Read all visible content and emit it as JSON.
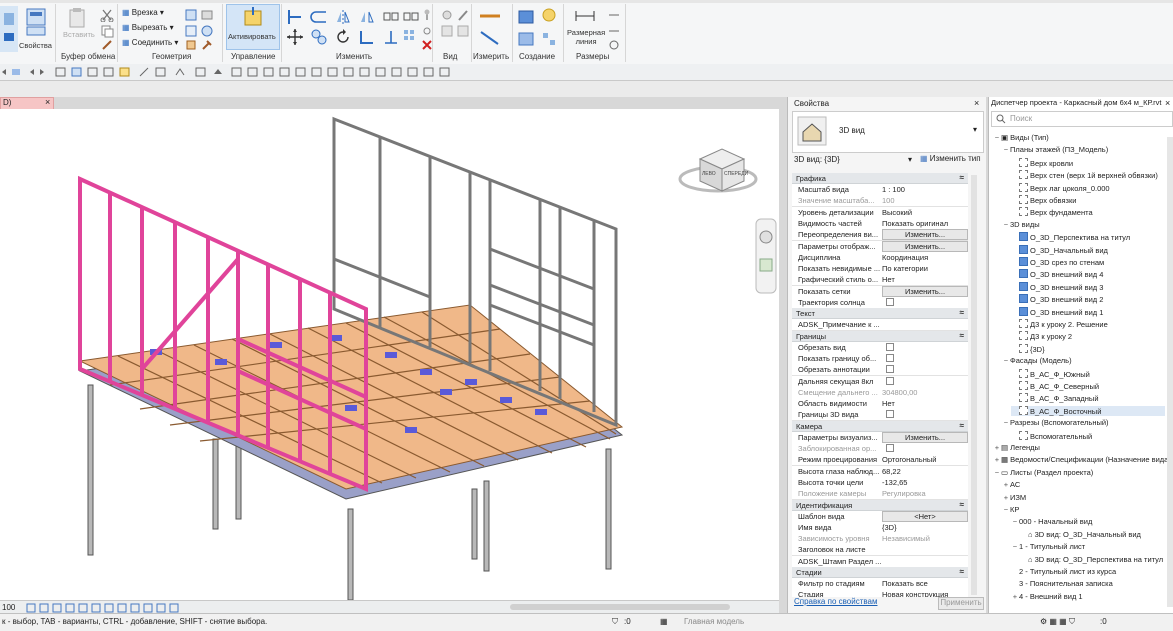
{
  "ribbon": {
    "buttons": {
      "modify": "",
      "properties": "Свойства",
      "paste": "Вставить",
      "cut_geom": "Врезка",
      "cut_out": "Вырезать",
      "join": "Соединить",
      "activate": "Активировать",
      "dimension": "Размерная\nлиния"
    },
    "groups": {
      "clipboard": "Буфер обмена",
      "geometry": "Геометрия",
      "control": "Управление",
      "modify": "Изменить",
      "view": "Вид",
      "measure": "Измерить",
      "create": "Создание",
      "dimensions": "Размеры"
    }
  },
  "view_tab": {
    "label": "D)",
    "close": "×"
  },
  "properties": {
    "title": "Свойства",
    "close": "×",
    "type_name": "3D вид",
    "instance_selector": "3D вид: {3D}",
    "edit_type": "Изменить тип",
    "help_link": "Справка по свойствам",
    "apply": "Применить",
    "sections": [
      {
        "name": "Графика",
        "rows": [
          {
            "k": "Масштаб вида",
            "v": "1 : 100"
          },
          {
            "k": "Значение масштаба...",
            "v": "100",
            "grey": true
          },
          {
            "k": "Уровень детализации",
            "v": "Высокий"
          },
          {
            "k": "Видимость частей",
            "v": "Показать оригинал"
          },
          {
            "k": "Переопределения ви...",
            "btn": "Изменить..."
          },
          {
            "k": "Параметры отображ...",
            "btn": "Изменить..."
          },
          {
            "k": "Дисциплина",
            "v": "Координация"
          },
          {
            "k": "Показать невидимые ...",
            "v": "По категории"
          },
          {
            "k": "Графический стиль о...",
            "v": "Нет"
          },
          {
            "k": "Показать сетки",
            "btn": "Изменить..."
          },
          {
            "k": "Траектория солнца",
            "chk": true
          }
        ]
      },
      {
        "name": "Текст",
        "rows": [
          {
            "k": "ADSK_Примечание к ...",
            "v": ""
          }
        ]
      },
      {
        "name": "Границы",
        "rows": [
          {
            "k": "Обрезать вид",
            "chk": true
          },
          {
            "k": "Показать границу об...",
            "chk": true
          },
          {
            "k": "Обрезать аннотации",
            "chk": true
          },
          {
            "k": "Дальняя секущая 8кл",
            "chk": true
          },
          {
            "k": "Смещение дальнего ...",
            "v": "304800,00",
            "grey": true
          },
          {
            "k": "Область видимости",
            "v": "Нет"
          },
          {
            "k": "Границы 3D вида",
            "chk": true
          }
        ]
      },
      {
        "name": "Камера",
        "rows": [
          {
            "k": "Параметры визуализ...",
            "btn": "Изменить..."
          },
          {
            "k": "Заблокированная ор...",
            "chk": true,
            "grey": true
          },
          {
            "k": "Режим проецирования",
            "v": "Ортогональный"
          },
          {
            "k": "Высота глаза наблюд...",
            "v": "68,22"
          },
          {
            "k": "Высота точки цели",
            "v": "-132,65"
          },
          {
            "k": "Положение камеры",
            "v": "Регулировка",
            "grey": true
          }
        ]
      },
      {
        "name": "Идентификация",
        "rows": [
          {
            "k": "Шаблон вида",
            "btn": "<Нет>"
          },
          {
            "k": "Имя вида",
            "v": "{3D}"
          },
          {
            "k": "Зависимость уровня",
            "v": "Независимый",
            "grey": true
          },
          {
            "k": "Заголовок на листе",
            "v": ""
          },
          {
            "k": "ADSK_Штамп Раздел ...",
            "v": ""
          }
        ]
      },
      {
        "name": "Стадии",
        "rows": [
          {
            "k": "Фильтр по стадиям",
            "v": "Показать все"
          },
          {
            "k": "Стадия",
            "v": "Новая конструкция"
          }
        ]
      }
    ]
  },
  "browser": {
    "title": "Диспетчер проекта - Каркасный дом 6х4 м_КР.rvt",
    "close": "×",
    "search_placeholder": "Поиск",
    "items": [
      {
        "t": "−",
        "label": "Виды (Тип)",
        "indent": 0,
        "icon": "views"
      },
      {
        "t": "−",
        "label": "Планы этажей (ПЗ_Модель)",
        "indent": 1
      },
      {
        "t": "",
        "label": "Верх кровли",
        "indent": 2,
        "icon": "dash"
      },
      {
        "t": "",
        "label": "Верх стен (верх 1й верхней обвязки)",
        "indent": 2,
        "icon": "dash"
      },
      {
        "t": "",
        "label": "Верх лаг цоколя_0.000",
        "indent": 2,
        "icon": "dash"
      },
      {
        "t": "",
        "label": "Верх обвязки",
        "indent": 2,
        "icon": "dash"
      },
      {
        "t": "",
        "label": "Верх фундамента",
        "indent": 2,
        "icon": "dash"
      },
      {
        "t": "−",
        "label": "3D виды",
        "indent": 1
      },
      {
        "t": "",
        "label": "О_3D_Перспектива на титул",
        "indent": 2,
        "icon": "blue"
      },
      {
        "t": "",
        "label": "О_3D_Начальный вид",
        "indent": 2,
        "icon": "blue"
      },
      {
        "t": "",
        "label": "О_3D срез по стенам",
        "indent": 2,
        "icon": "blue"
      },
      {
        "t": "",
        "label": "О_3D внешний вид 4",
        "indent": 2,
        "icon": "blue"
      },
      {
        "t": "",
        "label": "О_3D внешний вид 3",
        "indent": 2,
        "icon": "blue"
      },
      {
        "t": "",
        "label": "О_3D внешний вид 2",
        "indent": 2,
        "icon": "blue"
      },
      {
        "t": "",
        "label": "О_3D внешний вид 1",
        "indent": 2,
        "icon": "blue"
      },
      {
        "t": "",
        "label": "Д3 к уроку 2. Решение",
        "indent": 2,
        "icon": "dash"
      },
      {
        "t": "",
        "label": "Д3 к уроку 2",
        "indent": 2,
        "icon": "dash"
      },
      {
        "t": "",
        "label": "{3D}",
        "indent": 2,
        "icon": "dash"
      },
      {
        "t": "−",
        "label": "Фасады (Модель)",
        "indent": 1
      },
      {
        "t": "",
        "label": "В_АС_Ф_Южный",
        "indent": 2,
        "icon": "dash"
      },
      {
        "t": "",
        "label": "В_АС_Ф_Северный",
        "indent": 2,
        "icon": "dash"
      },
      {
        "t": "",
        "label": "В_АС_Ф_Западный",
        "indent": 2,
        "icon": "dash"
      },
      {
        "t": "",
        "label": "В_АС_Ф_Восточный",
        "indent": 2,
        "icon": "dash",
        "sel": true
      },
      {
        "t": "−",
        "label": "Разрезы (Вспомогательный)",
        "indent": 1
      },
      {
        "t": "",
        "label": "Вспомогательный",
        "indent": 2,
        "icon": "dash"
      },
      {
        "t": "+",
        "label": "Легенды",
        "indent": 0,
        "icon": "legend"
      },
      {
        "t": "+",
        "label": "Ведомости/Спецификации (Назначение вида)",
        "indent": 0,
        "icon": "table"
      },
      {
        "t": "−",
        "label": "Листы (Раздел проекта)",
        "indent": 0,
        "icon": "sheet"
      },
      {
        "t": "+",
        "label": "АС",
        "indent": 1
      },
      {
        "t": "+",
        "label": "ИЗМ",
        "indent": 1
      },
      {
        "t": "−",
        "label": "КР",
        "indent": 1
      },
      {
        "t": "−",
        "label": "000 - Начальный вид",
        "indent": 2
      },
      {
        "t": "",
        "label": "3D вид: О_3D_Начальный вид",
        "indent": 3,
        "icon": "house"
      },
      {
        "t": "−",
        "label": "1 - Титульный лист",
        "indent": 2
      },
      {
        "t": "",
        "label": "3D вид: О_3D_Перспектива на титул",
        "indent": 3,
        "icon": "house"
      },
      {
        "t": "",
        "label": "2 - Титульный лист из курса",
        "indent": 2
      },
      {
        "t": "",
        "label": "3 - Пояснительная записка",
        "indent": 2
      },
      {
        "t": "+",
        "label": "4 - Внешний вид 1",
        "indent": 2
      }
    ]
  },
  "viewbar": {
    "scale": "100"
  },
  "status": {
    "hint": "к - выбор, TAB - варианты, CTRL - добавление, SHIFT - снятие выбора.",
    "filter_count": ":0",
    "model": "Главная модель",
    "filter_count2": ":0"
  },
  "viewcube": {
    "faces": [
      "ЛЕВО",
      "СПЕРЕДИ"
    ]
  }
}
